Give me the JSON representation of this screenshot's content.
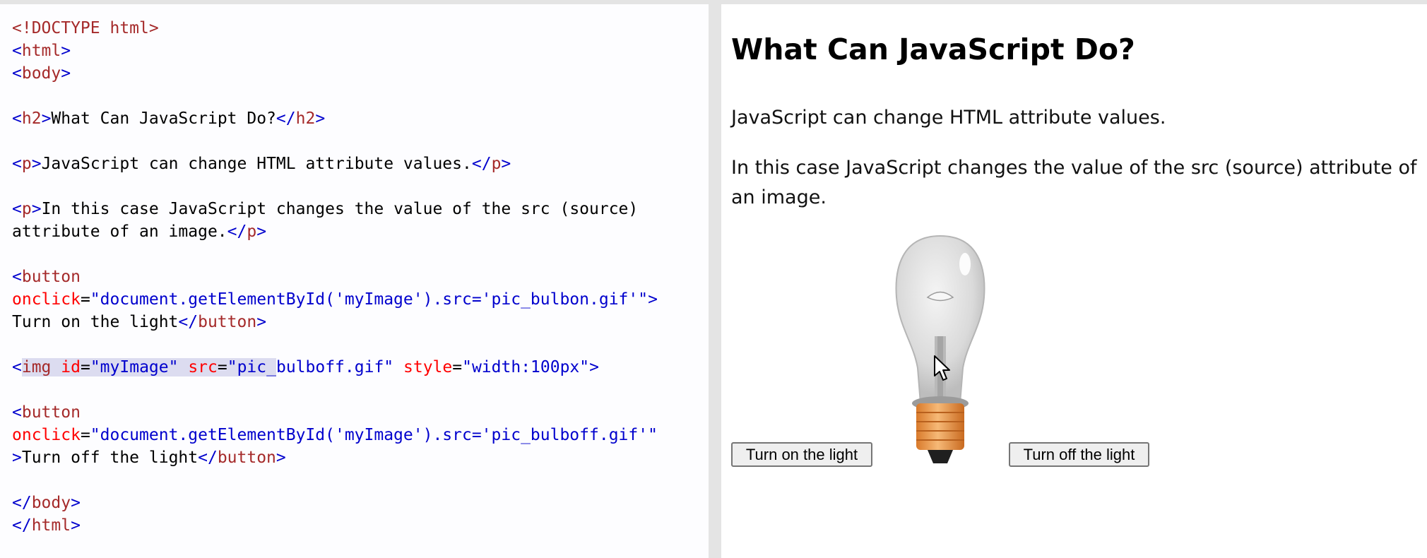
{
  "editor": {
    "lines": [
      [
        {
          "c": "name",
          "t": "<!DOCTYPE html>"
        }
      ],
      [
        {
          "c": "tag",
          "t": "<"
        },
        {
          "c": "name",
          "t": "html"
        },
        {
          "c": "tag",
          "t": ">"
        }
      ],
      [
        {
          "c": "tag",
          "t": "<"
        },
        {
          "c": "name",
          "t": "body"
        },
        {
          "c": "tag",
          "t": ">"
        }
      ],
      [],
      [
        {
          "c": "tag",
          "t": "<"
        },
        {
          "c": "name",
          "t": "h2"
        },
        {
          "c": "tag",
          "t": ">"
        },
        {
          "c": "txt",
          "t": "What Can JavaScript Do?"
        },
        {
          "c": "tag",
          "t": "</"
        },
        {
          "c": "name",
          "t": "h2"
        },
        {
          "c": "tag",
          "t": ">"
        }
      ],
      [],
      [
        {
          "c": "tag",
          "t": "<"
        },
        {
          "c": "name",
          "t": "p"
        },
        {
          "c": "tag",
          "t": ">"
        },
        {
          "c": "txt",
          "t": "JavaScript can change HTML attribute values."
        },
        {
          "c": "tag",
          "t": "</"
        },
        {
          "c": "name",
          "t": "p"
        },
        {
          "c": "tag",
          "t": ">"
        }
      ],
      [],
      [
        {
          "c": "tag",
          "t": "<"
        },
        {
          "c": "name",
          "t": "p"
        },
        {
          "c": "tag",
          "t": ">"
        },
        {
          "c": "txt",
          "t": "In this case JavaScript changes the value of the src (source)"
        }
      ],
      [
        {
          "c": "txt",
          "t": "attribute of an image."
        },
        {
          "c": "tag",
          "t": "</"
        },
        {
          "c": "name",
          "t": "p"
        },
        {
          "c": "tag",
          "t": ">"
        }
      ],
      [],
      [
        {
          "c": "tag",
          "t": "<"
        },
        {
          "c": "name",
          "t": "button"
        }
      ],
      [
        {
          "c": "attr",
          "t": "onclick"
        },
        {
          "c": "txt",
          "t": "="
        },
        {
          "c": "val",
          "t": "\"document.getElementById('myImage').src='pic_bulbon.gif'\""
        },
        {
          "c": "tag",
          "t": ">"
        }
      ],
      [
        {
          "c": "txt",
          "t": "Turn on the light"
        },
        {
          "c": "tag",
          "t": "</"
        },
        {
          "c": "name",
          "t": "button"
        },
        {
          "c": "tag",
          "t": ">"
        }
      ],
      [],
      [
        {
          "c": "tag",
          "t": "<"
        },
        {
          "c": "name sel",
          "t": "img"
        },
        {
          "c": "sel",
          "t": " "
        },
        {
          "c": "attr sel",
          "t": "id"
        },
        {
          "c": "txt sel",
          "t": "="
        },
        {
          "c": "val sel",
          "t": "\"myImage\""
        },
        {
          "c": "sel",
          "t": " "
        },
        {
          "c": "attr sel",
          "t": "src"
        },
        {
          "c": "txt sel",
          "t": "="
        },
        {
          "c": "val sel",
          "t": "\"pic_"
        },
        {
          "c": "val",
          "t": "bulboff.gif\""
        },
        {
          "c": "txt",
          "t": " "
        },
        {
          "c": "attr",
          "t": "style"
        },
        {
          "c": "txt",
          "t": "="
        },
        {
          "c": "val",
          "t": "\"width:100px\""
        },
        {
          "c": "tag",
          "t": ">"
        }
      ],
      [],
      [
        {
          "c": "tag",
          "t": "<"
        },
        {
          "c": "name",
          "t": "button"
        }
      ],
      [
        {
          "c": "attr",
          "t": "onclick"
        },
        {
          "c": "txt",
          "t": "="
        },
        {
          "c": "val",
          "t": "\"document.getElementById('myImage').src='pic_bulboff.gif'\""
        }
      ],
      [
        {
          "c": "tag",
          "t": ">"
        },
        {
          "c": "txt",
          "t": "Turn off the light"
        },
        {
          "c": "tag",
          "t": "</"
        },
        {
          "c": "name",
          "t": "button"
        },
        {
          "c": "tag",
          "t": ">"
        }
      ],
      [],
      [
        {
          "c": "tag",
          "t": "</"
        },
        {
          "c": "name",
          "t": "body"
        },
        {
          "c": "tag",
          "t": ">"
        }
      ],
      [
        {
          "c": "tag",
          "t": "</"
        },
        {
          "c": "name",
          "t": "html"
        },
        {
          "c": "tag",
          "t": ">"
        }
      ]
    ]
  },
  "preview": {
    "title": "What Can JavaScript Do?",
    "paragraph1": "JavaScript can change HTML attribute values.",
    "paragraph2": "In this case JavaScript changes the value of the src (source) attribute of an image.",
    "button_on": "Turn on the light",
    "button_off": "Turn off the light",
    "image_icon": "lightbulb-off-icon",
    "cursor_icon": "mouse-pointer-icon"
  }
}
